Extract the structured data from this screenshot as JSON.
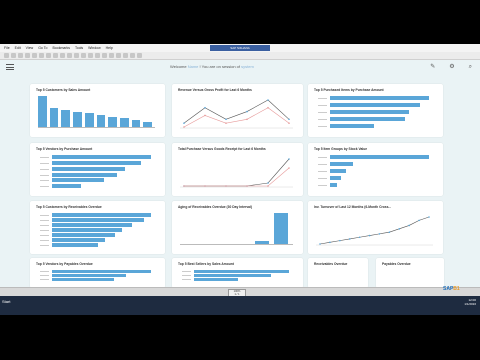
{
  "window": {
    "title": "SAP S/4HANA"
  },
  "menu": [
    "File",
    "Edit",
    "View",
    "Go To",
    "Bookmarks",
    "Tools",
    "Window",
    "Help"
  ],
  "header": {
    "welcome_prefix": "Welcome",
    "welcome_user": "Name",
    "welcome_suffix": "! You are on session of",
    "welcome_session": "system"
  },
  "cards": [
    {
      "title": "Top 5 Customers by Sales Amount",
      "chart_data": {
        "type": "bar",
        "values": [
          18,
          11,
          10,
          9,
          8,
          7,
          6,
          5,
          4,
          3
        ]
      }
    },
    {
      "title": "Revenue Versus Gross Profit for Last 6 Months",
      "chart_data": {
        "type": "line",
        "x": [
          "Jan",
          "Feb",
          "Mar",
          "Apr",
          "May",
          "Jun"
        ],
        "series": [
          {
            "values": [
              2,
              6,
              3,
              5,
              8,
              3
            ]
          },
          {
            "values": [
              1,
              4,
              2,
              3,
              6,
              2
            ]
          }
        ]
      }
    },
    {
      "title": "Top 5 Purchased Items by Purchase Amount",
      "chart_data": {
        "type": "bar",
        "values": [
          90,
          82,
          72,
          68,
          40
        ]
      }
    },
    {
      "title": "Top 5 Vendors by Purchase Amount",
      "chart_data": {
        "type": "bar",
        "values": [
          95,
          85,
          70,
          62,
          50,
          28
        ]
      }
    },
    {
      "title": "Total Purchase Versus Goods Receipt for Last 6 Months",
      "chart_data": {
        "type": "line",
        "x": [
          "Jan",
          "Feb",
          "Mar",
          "Apr",
          "May",
          "Jun"
        ],
        "series": [
          {
            "values": [
              0,
              0,
              0,
              0,
              1,
              9
            ]
          },
          {
            "values": [
              0,
              0,
              0,
              0,
              0,
              6
            ]
          }
        ]
      }
    },
    {
      "title": "Top 5 Item Groups by Stock Value",
      "chart_data": {
        "type": "bar",
        "values": [
          88,
          20,
          14,
          10,
          6
        ]
      }
    },
    {
      "title": "Top 5 Customers by Receivables Overdue",
      "chart_data": {
        "type": "bar",
        "values": [
          82,
          76,
          66,
          58,
          52,
          44,
          38
        ]
      }
    },
    {
      "title": "Aging of Receivables Overdue (30 Day Interval)",
      "chart_data": {
        "type": "bar",
        "values": [
          0,
          0,
          0,
          0,
          1,
          10
        ]
      }
    },
    {
      "title": "Inv. Turnover of Last 12 Months (6-Month Cross...",
      "chart_data": {
        "type": "line",
        "x": [
          "1",
          "2",
          "3",
          "4",
          "5",
          "6",
          "7",
          "8",
          "9",
          "10",
          "11",
          "12"
        ],
        "series": [
          {
            "values": [
              1,
              1.5,
              2,
              2.5,
              3,
              3.5,
              4,
              4.5,
              5.5,
              6.5,
              8,
              9
            ]
          }
        ]
      }
    },
    {
      "title": "Top 5 Vendors by Payables Overdue",
      "chart_data": {
        "type": "bar",
        "values": [
          80,
          60,
          50
        ]
      }
    },
    {
      "title": "Top 5 Best Sellers by Sales Amount",
      "chart_data": {
        "type": "bar",
        "values": [
          86,
          70,
          40
        ]
      }
    },
    {
      "title": "Receivables Overdue",
      "chart_data": {
        "type": "bar",
        "values": []
      }
    },
    {
      "title": "Payables Overdue",
      "chart_data": {
        "type": "bar",
        "values": []
      }
    }
  ],
  "overlay": {
    "zoom": "100%",
    "page": "1 / 1"
  },
  "brand": {
    "name": "SAP",
    "suffix": "B1"
  },
  "taskbar": {
    "start": "Start",
    "time": "12:00",
    "date": "1/1/2016"
  }
}
